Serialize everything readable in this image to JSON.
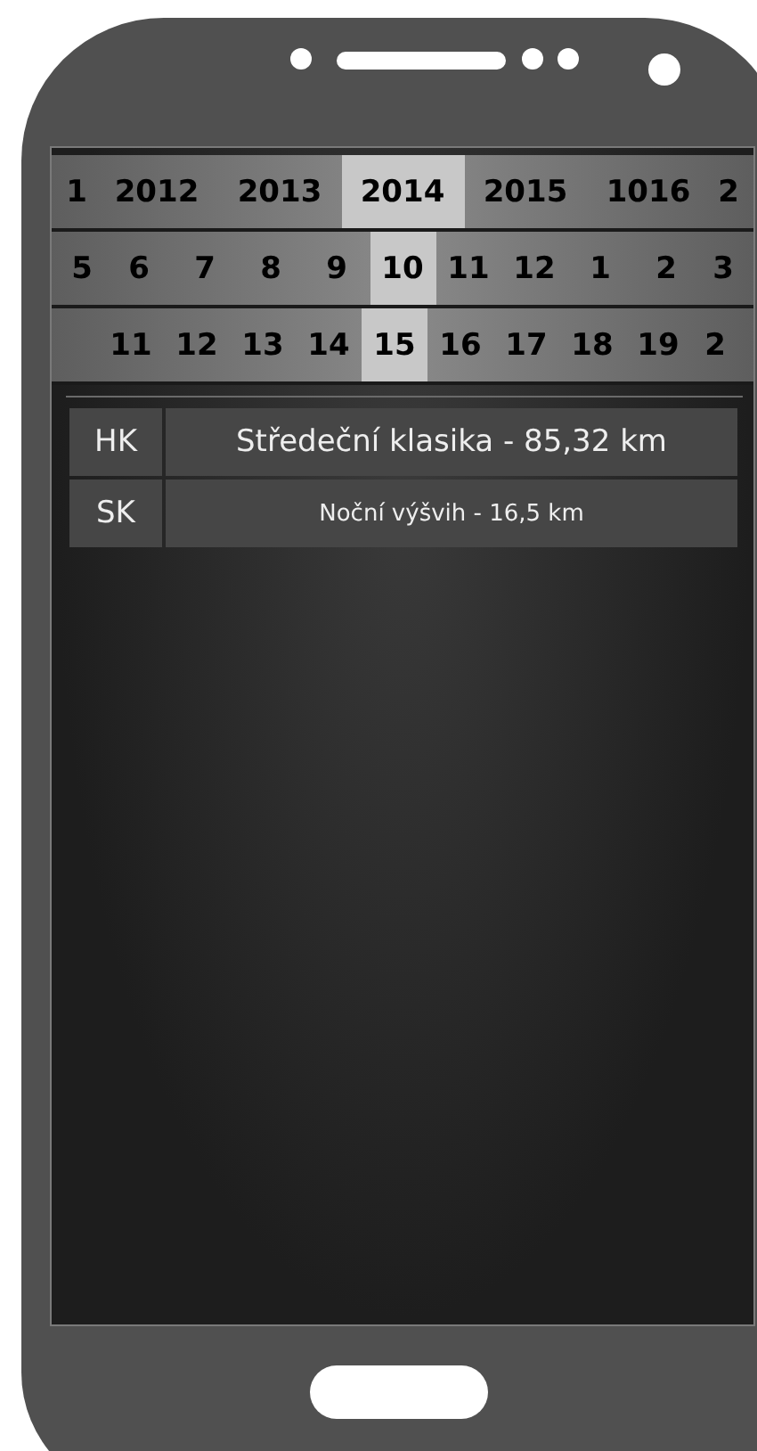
{
  "picker": {
    "rows": [
      {
        "items": [
          {
            "label": "1",
            "selected": false
          },
          {
            "label": "2012",
            "selected": false
          },
          {
            "label": "2013",
            "selected": false
          },
          {
            "label": "2014",
            "selected": true
          },
          {
            "label": "2015",
            "selected": false
          },
          {
            "label": "1016",
            "selected": false
          },
          {
            "label": "2",
            "selected": false
          }
        ]
      },
      {
        "items": [
          {
            "label": "5",
            "selected": false
          },
          {
            "label": "6",
            "selected": false
          },
          {
            "label": "7",
            "selected": false
          },
          {
            "label": "8",
            "selected": false
          },
          {
            "label": "9",
            "selected": false
          },
          {
            "label": "10",
            "selected": true
          },
          {
            "label": "11",
            "selected": false
          },
          {
            "label": "12",
            "selected": false
          },
          {
            "label": "1",
            "selected": false
          },
          {
            "label": "2",
            "selected": false
          },
          {
            "label": "3",
            "selected": false
          }
        ]
      },
      {
        "items": [
          {
            "label": "11",
            "selected": false
          },
          {
            "label": "12",
            "selected": false
          },
          {
            "label": "13",
            "selected": false
          },
          {
            "label": "14",
            "selected": false
          },
          {
            "label": "15",
            "selected": true
          },
          {
            "label": "16",
            "selected": false
          },
          {
            "label": "17",
            "selected": false
          },
          {
            "label": "18",
            "selected": false
          },
          {
            "label": "19",
            "selected": false
          },
          {
            "label": "2",
            "selected": false
          }
        ]
      }
    ]
  },
  "events": [
    {
      "code": "HK",
      "title": "Středeční klasika - 85,32 km",
      "kind": "large"
    },
    {
      "code": "SK",
      "title": "Noční výšvih - 16,5 km",
      "kind": "small"
    }
  ]
}
